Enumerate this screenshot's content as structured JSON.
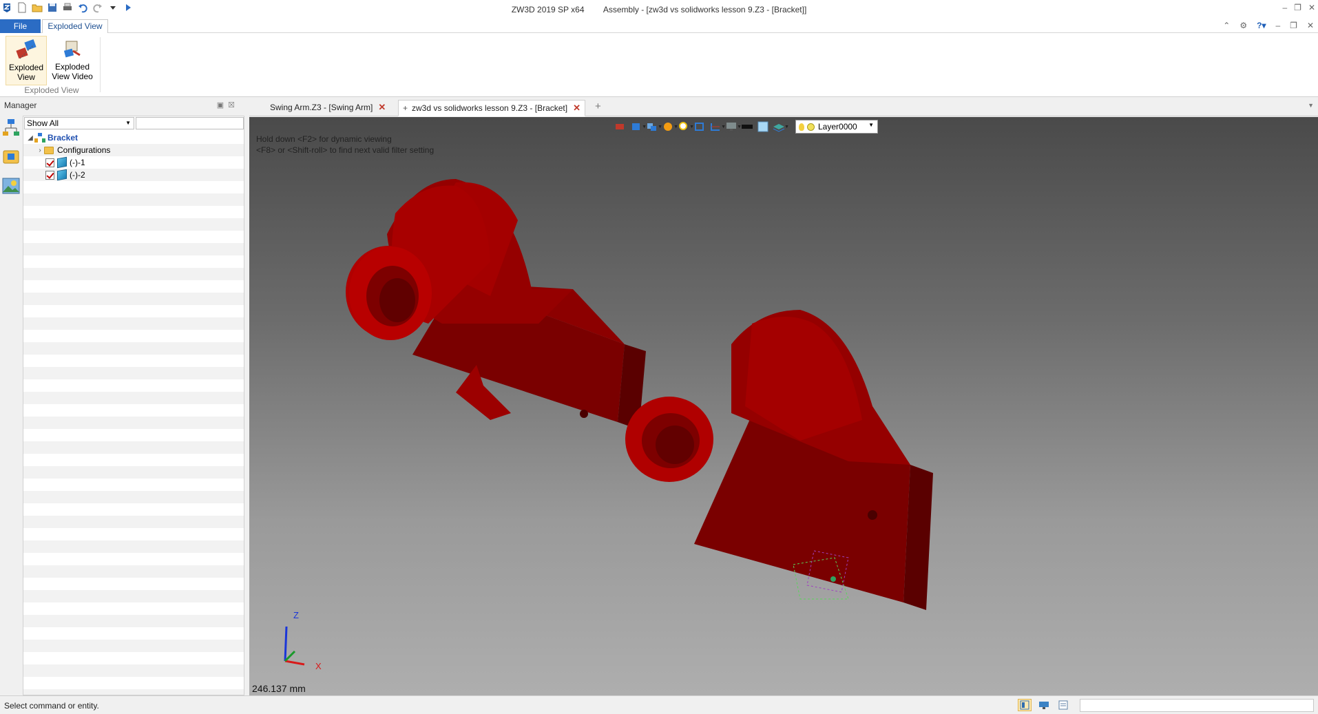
{
  "titlebar": {
    "app_name": "ZW3D 2019 SP x64",
    "document_title": "Assembly - [zw3d vs solidworks lesson 9.Z3 - [Bracket]]",
    "window_controls": [
      "minimize-icon",
      "restore-icon",
      "close-icon"
    ]
  },
  "ribbon": {
    "tabs": [
      {
        "label": "File",
        "color": "#2b6cc4"
      },
      {
        "label": "Exploded View"
      }
    ],
    "buttons": [
      {
        "label_line1": "Exploded",
        "label_line2": "View",
        "icon": "exploded-view-icon"
      },
      {
        "label_line1": "Exploded",
        "label_line2": "View Video",
        "icon": "exploded-view-video-icon"
      }
    ],
    "group_label": "Exploded View",
    "right_icons": [
      "collapse-ribbon-icon",
      "settings-gear-icon",
      "help-icon"
    ]
  },
  "manager": {
    "title": "Manager",
    "filter_value": "Show All",
    "filter_search_value": "",
    "tree": [
      {
        "label": "Bracket",
        "icon": "assembly-icon",
        "level": 0,
        "expanded": true
      },
      {
        "label": "Configurations",
        "icon": "folder-icon",
        "level": 1,
        "expanded": false
      },
      {
        "label": "(-)-1",
        "icon": "part-cube-icon",
        "level": 1,
        "checked": true
      },
      {
        "label": "(-)-2",
        "icon": "part-cube-icon",
        "level": 1,
        "checked": true
      }
    ]
  },
  "doc_tabs": [
    {
      "label": "Swing Arm.Z3 - [Swing Arm]",
      "active": false
    },
    {
      "label": "zw3d vs solidworks lesson 9.Z3 - [Bracket]",
      "active": true,
      "pinned": true
    }
  ],
  "viewport": {
    "hint_line1": "Hold down <F2> for dynamic viewing",
    "hint_line2": "<F8> or <Shift-roll> to find next valid filter setting",
    "layer": "Layer0000",
    "scale_readout": "246.137 mm",
    "axis_labels": {
      "z": "Z",
      "x": "X"
    },
    "model_color": "#b00000"
  },
  "statusbar": {
    "message": "Select command or entity.",
    "input_value": ""
  }
}
